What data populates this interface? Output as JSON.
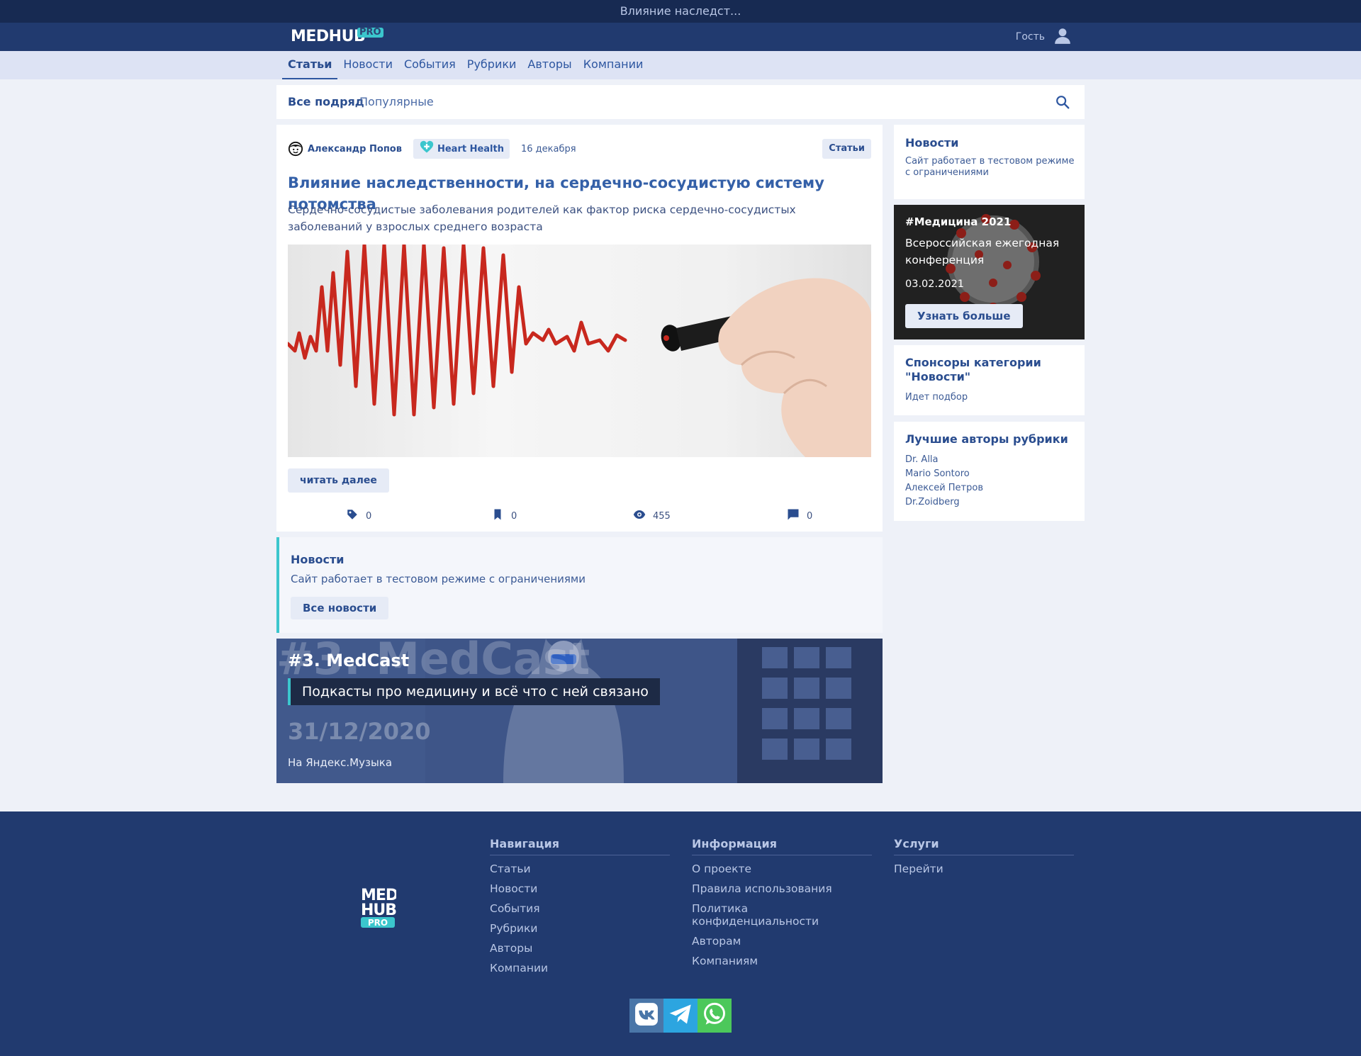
{
  "window": {
    "title": "Влияние наследст..."
  },
  "header": {
    "logo_main": "MEDHUB",
    "logo_pro": "PRO",
    "guest_label": "Гость",
    "colors": {
      "header_bg": "#213a6f",
      "topbar_bg": "#172a52",
      "accent": "#3bc6cd"
    }
  },
  "subnav": {
    "items": [
      {
        "label": "Статьи",
        "active": true
      },
      {
        "label": "Новости"
      },
      {
        "label": "События"
      },
      {
        "label": "Рубрики"
      },
      {
        "label": "Авторы"
      },
      {
        "label": "Компании"
      }
    ]
  },
  "filters": {
    "all": "Все подряд",
    "popular": "Популярные",
    "search_icon": "search-icon"
  },
  "article": {
    "author": "Александр Попов",
    "rubric": "Heart Health",
    "date": "16 декабря",
    "category": "Статьи",
    "title": "Влияние наследственности, на сердечно-сосудистую систему потомства",
    "lead": "Сердечно-сосудистые заболевания родителей как фактор риска сердечно-сосудистых заболеваний у взрослых среднего возраста",
    "read_more": "читать далее",
    "stats": {
      "tags": "0",
      "bookmarks": "0",
      "views": "455",
      "comments": "0"
    }
  },
  "news_box": {
    "title": "Новости",
    "text": "Сайт работает в тестовом режиме с ограничениями",
    "button": "Все новости"
  },
  "podcast": {
    "bg_text": "#3. MedCast",
    "title": "#3. MedCast",
    "subtitle": "Подкасты про медицину и всё что с ней связано",
    "date": "31/12/2020",
    "where": "На Яндекс.Музыка"
  },
  "sidebar": {
    "news": {
      "title": "Новости",
      "text": "Сайт работает в тестовом режиме с ограничениями"
    },
    "promo": {
      "tag": "#Медицина 2021",
      "text": "Всероссийская ежегодная конференция",
      "date": "03.02.2021",
      "button": "Узнать больше"
    },
    "sponsors": {
      "title": "Спонсоры категории \"Новости\"",
      "text": "Идет подбор"
    },
    "best_authors": {
      "title": "Лучшие авторы рубрики",
      "items": [
        "Dr. Alla",
        "Mario Sontoro",
        "Алексей Петров",
        "Dr.Zoidberg"
      ]
    }
  },
  "footer": {
    "logo": {
      "line1": "MED",
      "line2": "HUB",
      "pro": "PRO"
    },
    "navigation": {
      "title": "Навигация",
      "links": [
        "Статьи",
        "Новости",
        "События",
        "Рубрики",
        "Авторы",
        "Компании"
      ]
    },
    "info": {
      "title": "Информация",
      "links": [
        "О проекте",
        "Правила использования",
        "Политика конфиденциальности",
        "Авторам",
        "Компаниям"
      ]
    },
    "services": {
      "title": "Услуги",
      "links": [
        "Перейти"
      ]
    },
    "socials": [
      {
        "icon": "vk-icon",
        "color": "#4a76a8"
      },
      {
        "icon": "telegram-icon",
        "color": "#2ca5e0"
      },
      {
        "icon": "whatsapp-icon",
        "color": "#4cc85b"
      }
    ]
  }
}
